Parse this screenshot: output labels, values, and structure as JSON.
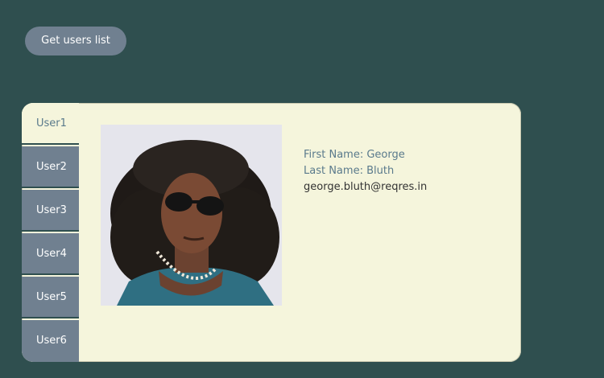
{
  "header": {
    "get_users_label": "Get users list"
  },
  "tabs": [
    {
      "label": "User1",
      "active": true
    },
    {
      "label": "User2",
      "active": false
    },
    {
      "label": "User3",
      "active": false
    },
    {
      "label": "User4",
      "active": false
    },
    {
      "label": "User5",
      "active": false
    },
    {
      "label": "User6",
      "active": false
    }
  ],
  "user": {
    "first_name_line": "First Name: George",
    "last_name_line": "Last Name: Bluth",
    "email": "george.bluth@reqres.in"
  },
  "colors": {
    "page_background": "#2f4f4f",
    "button_background": "#708090",
    "card_background": "#f5f5dc",
    "label_text": "#5a7a8c"
  }
}
